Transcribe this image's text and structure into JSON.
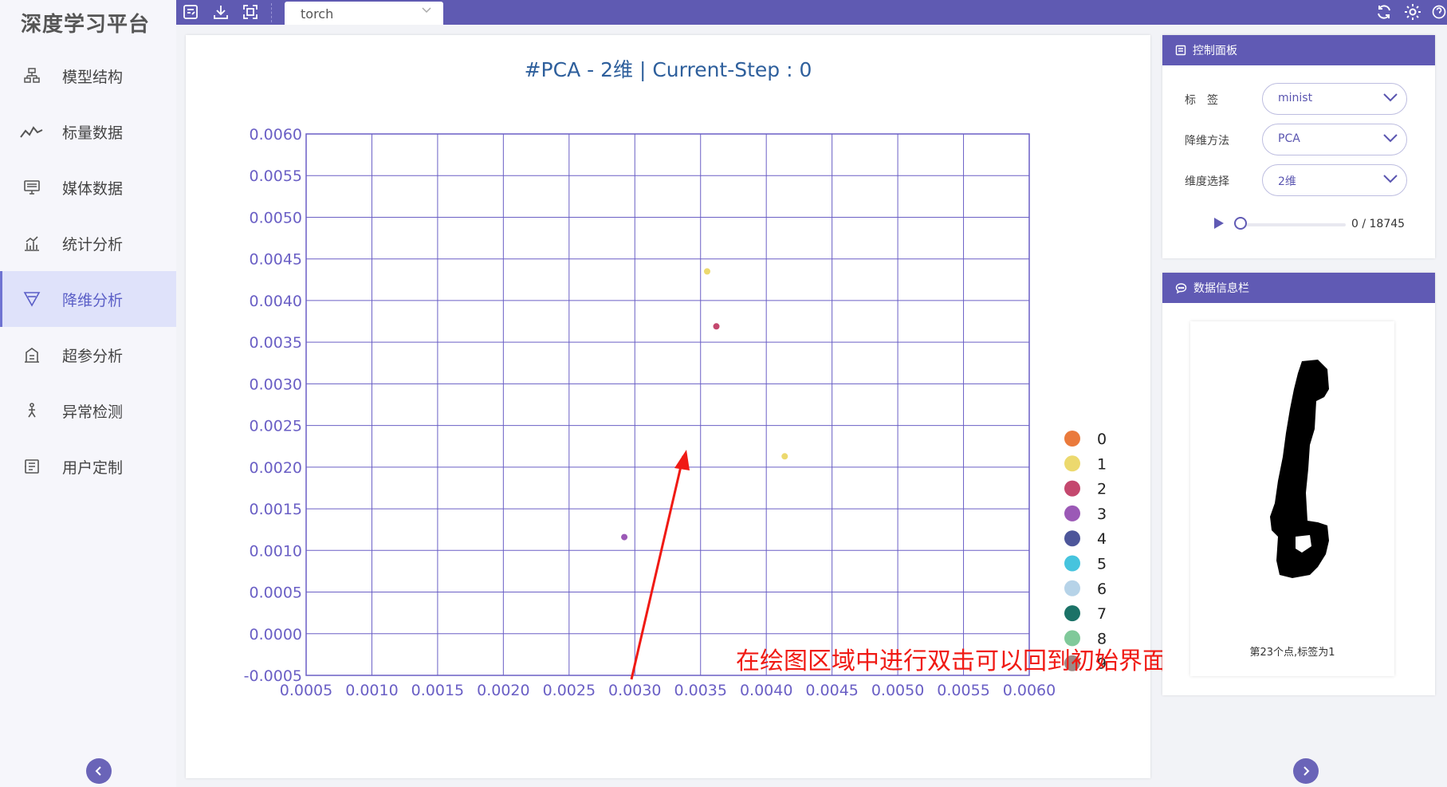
{
  "app": {
    "logo": "深度学习平台"
  },
  "sidebar": {
    "items": [
      {
        "label": "模型结构",
        "icon": "model-structure-icon"
      },
      {
        "label": "标量数据",
        "icon": "line-chart-icon"
      },
      {
        "label": "媒体数据",
        "icon": "monitor-icon"
      },
      {
        "label": "统计分析",
        "icon": "bar-stats-icon"
      },
      {
        "label": "降维分析",
        "icon": "funnel-icon",
        "active": true
      },
      {
        "label": "超参分析",
        "icon": "building-icon"
      },
      {
        "label": "异常检测",
        "icon": "runner-icon"
      },
      {
        "label": "用户定制",
        "icon": "custom-icon"
      }
    ]
  },
  "toolbar": {
    "tab_label": "torch"
  },
  "chart": {
    "title": "#PCA - 2维 | Current-Step : 0"
  },
  "chart_data": {
    "type": "scatter",
    "title": "#PCA - 2维 | Current-Step : 0",
    "xlim": [
      0.0005,
      0.006
    ],
    "ylim": [
      -0.0005,
      0.006
    ],
    "x_ticks": [
      "0.0005",
      "0.0010",
      "0.0015",
      "0.0020",
      "0.0025",
      "0.0030",
      "0.0035",
      "0.0040",
      "0.0045",
      "0.0050",
      "0.0055",
      "0.0060"
    ],
    "y_ticks": [
      "0.0060",
      "0.0055",
      "0.0050",
      "0.0045",
      "0.0040",
      "0.0035",
      "0.0030",
      "0.0025",
      "0.0020",
      "0.0015",
      "0.0010",
      "0.0005",
      "0.0000",
      "-0.0005"
    ],
    "grid": true,
    "legend_position": "right",
    "series": [
      {
        "name": "0",
        "color": "#ea7a3c",
        "points": []
      },
      {
        "name": "1",
        "color": "#ecd96e",
        "points": [
          [
            0.00355,
            0.00435
          ],
          [
            0.00414,
            0.00213
          ]
        ]
      },
      {
        "name": "2",
        "color": "#c4486e",
        "points": [
          [
            0.00362,
            0.00369
          ]
        ]
      },
      {
        "name": "3",
        "color": "#9b59b6",
        "points": [
          [
            0.00292,
            0.00116
          ]
        ]
      },
      {
        "name": "4",
        "color": "#4d569a",
        "points": []
      },
      {
        "name": "5",
        "color": "#46c4de",
        "points": []
      },
      {
        "name": "6",
        "color": "#b6d3e8",
        "points": []
      },
      {
        "name": "7",
        "color": "#1b7267",
        "points": []
      },
      {
        "name": "8",
        "color": "#80c99a",
        "points": []
      },
      {
        "name": "9",
        "color": "#9b8a86",
        "points": []
      }
    ]
  },
  "annotation": {
    "text": "在绘图区域中进行双击可以回到初始界面",
    "color": "#f01a14"
  },
  "control_panel": {
    "title": "控制面板",
    "label_label": "标　签",
    "label_value": "minist",
    "method_label": "降维方法",
    "method_value": "PCA",
    "dim_label": "维度选择",
    "dim_value": "2维",
    "step_text": "0 / 18745",
    "progress": 0
  },
  "info_panel": {
    "title": "数据信息栏",
    "caption": "第23个点,标签为1"
  },
  "colors": {
    "accent": "#5f5ab2",
    "axis": "#6a5fc5"
  }
}
